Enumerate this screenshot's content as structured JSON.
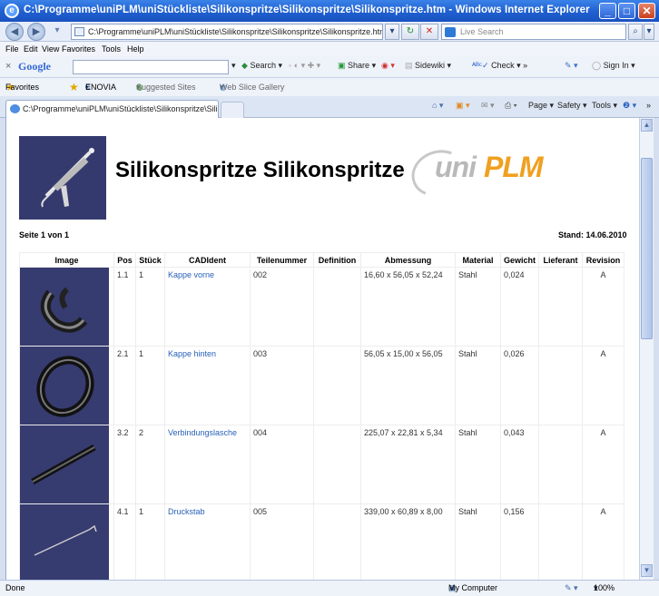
{
  "window": {
    "title": "C:\\Programme\\uniPLM\\uniStückliste\\Silikonspritze\\Silikonspritze\\Silikonspritze.htm - Windows Internet Explorer"
  },
  "address_bar": {
    "url": "C:\\Programme\\uniPLM\\uniStückliste\\Silikonspritze\\Silikonspritze\\Silikonspritze.htm",
    "search_placeholder": "Live Search"
  },
  "menu": [
    "File",
    "Edit",
    "View",
    "Favorites",
    "Tools",
    "Help"
  ],
  "google_toolbar": {
    "brand": "Google",
    "search_label": "Search",
    "share_label": "Share",
    "sidewiki_label": "Sidewiki",
    "check_label": "Check",
    "more_label": "»",
    "signin_label": "Sign In"
  },
  "favorites_bar": {
    "favorites_label": "Favorites",
    "enovia_label": "ENOVIA",
    "suggested_label": "Suggested Sites",
    "webslice_label": "Web Slice Gallery"
  },
  "tab": {
    "label": "C:\\Programme\\uniPLM\\uniStückliste\\Silikonspritze\\Silik..."
  },
  "command_bar": {
    "page_label": "Page",
    "safety_label": "Safety",
    "tools_label": "Tools",
    "more_label": "»"
  },
  "page": {
    "title": "Silikonspritze Silikonspritze",
    "logo_uni": "uni",
    "logo_plm": "PLM",
    "page_info": "Seite 1 von 1",
    "stand": "Stand: 14.06.2010"
  },
  "table": {
    "headers": [
      "Image",
      "Pos",
      "Stück",
      "CADIdent",
      "Teilenummer",
      "Definition",
      "Abmessung",
      "Material",
      "Gewicht",
      "Lieferant",
      "Revision"
    ],
    "rows": [
      {
        "pos": "1.1",
        "stueck": "1",
        "cadident": "Kappe vorne",
        "teilenummer": "002",
        "definition": "",
        "abmessung": "16,60 x 56,05 x 52,24",
        "material": "Stahl",
        "gewicht": "0,024",
        "lieferant": "",
        "revision": "A",
        "image_icon": "cap-front-part-icon"
      },
      {
        "pos": "2.1",
        "stueck": "1",
        "cadident": "Kappe hinten",
        "teilenummer": "003",
        "definition": "",
        "abmessung": "56,05 x 15,00 x 56,05",
        "material": "Stahl",
        "gewicht": "0,026",
        "lieferant": "",
        "revision": "A",
        "image_icon": "ring-part-icon"
      },
      {
        "pos": "3.2",
        "stueck": "2",
        "cadident": "Verbindungslasche",
        "teilenummer": "004",
        "definition": "",
        "abmessung": "225,07 x 22,81 x 5,34",
        "material": "Stahl",
        "gewicht": "0,043",
        "lieferant": "",
        "revision": "A",
        "image_icon": "strap-part-icon"
      },
      {
        "pos": "4.1",
        "stueck": "1",
        "cadident": "Druckstab",
        "teilenummer": "005",
        "definition": "",
        "abmessung": "339,00 x 60,89 x 8,00",
        "material": "Stahl",
        "gewicht": "0,156",
        "lieferant": "",
        "revision": "A",
        "image_icon": "rod-part-icon"
      }
    ]
  },
  "status_bar": {
    "status": "Done",
    "zone": "My Computer",
    "zoom": "100%"
  },
  "colors": {
    "titlebar": "#1f5fd0",
    "thumbnail_bg": "#363b70",
    "link": "#2861b8",
    "logo_orange": "#f0a020"
  }
}
